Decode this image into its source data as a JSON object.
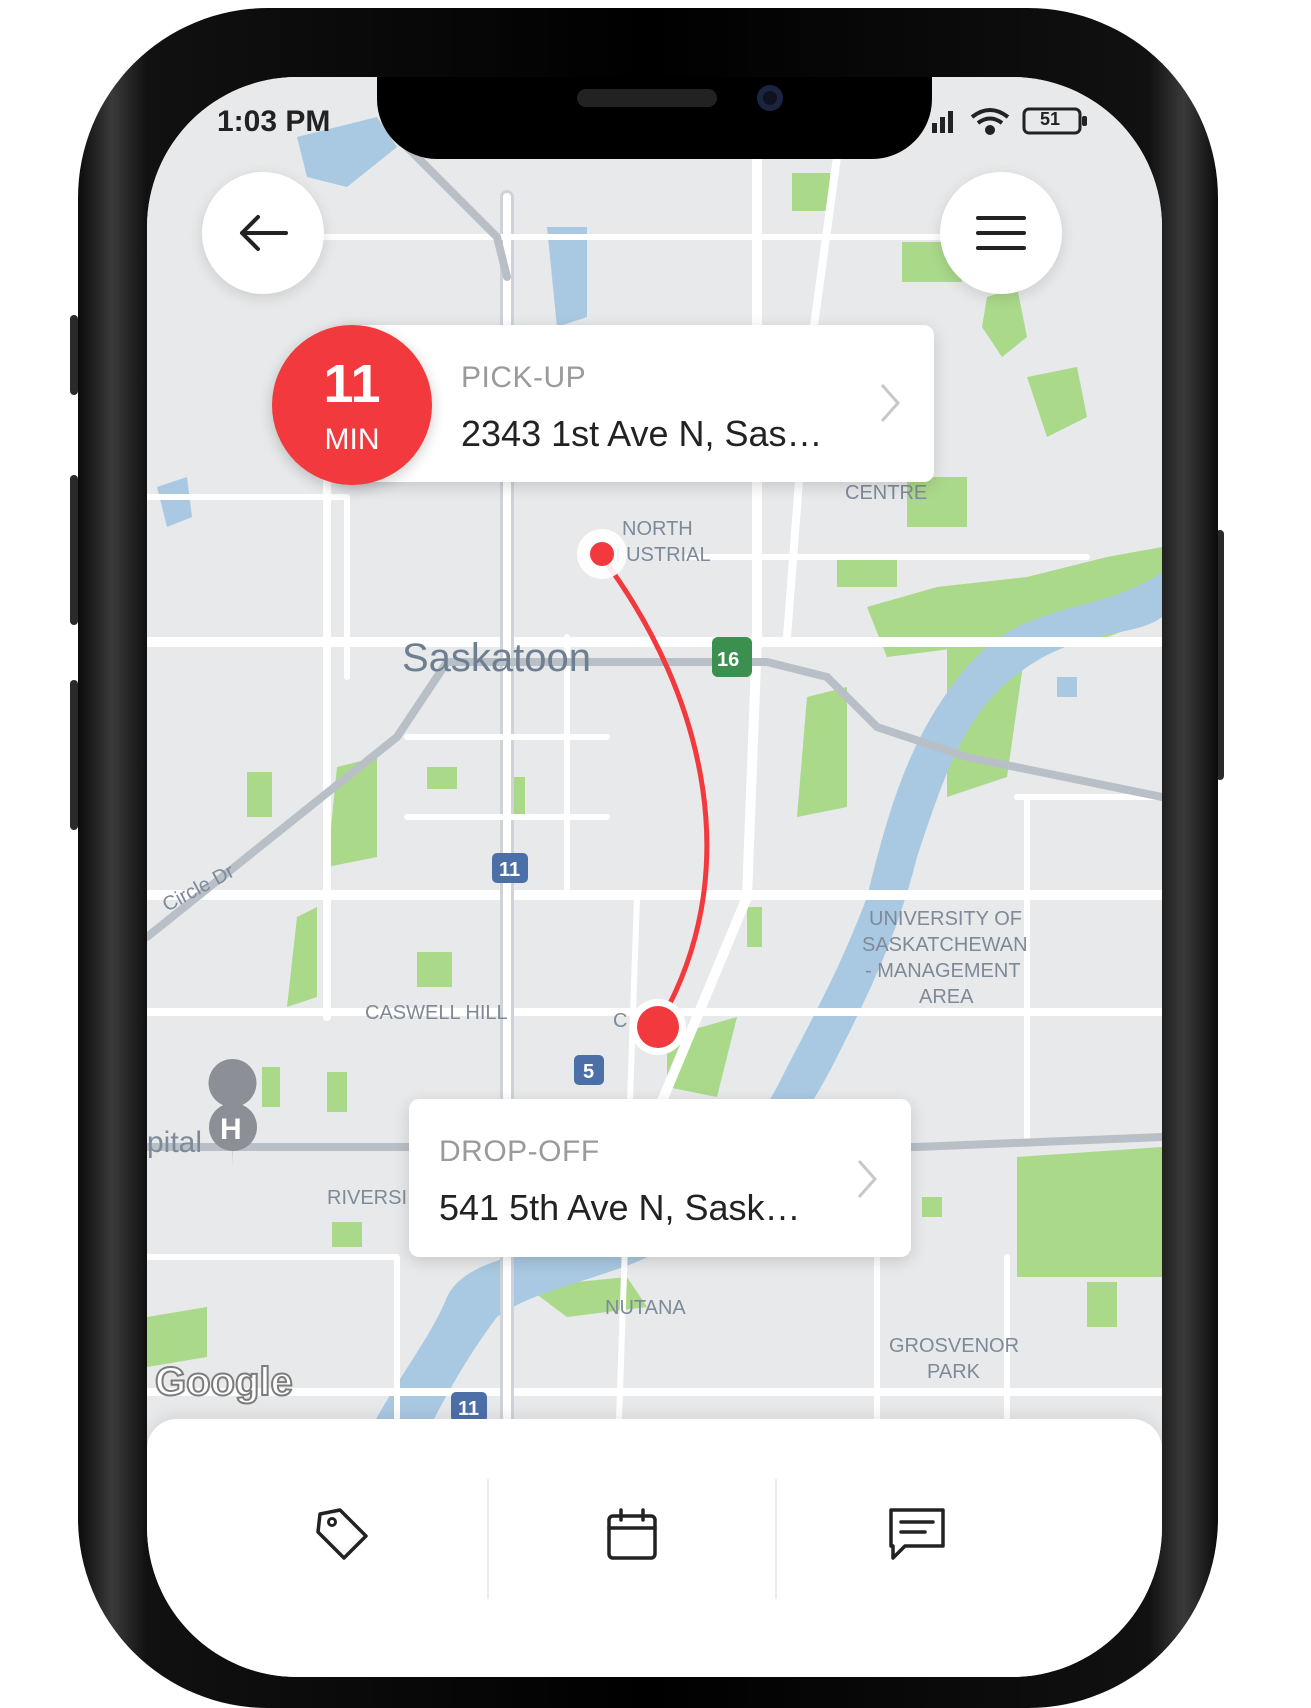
{
  "status": {
    "time": "1:03 PM",
    "battery": "51"
  },
  "route_badge": {
    "minutes": "11",
    "unit": "MIN"
  },
  "pickup": {
    "label": "PICK-UP",
    "address": "2343 1st Ave N, Sas…"
  },
  "dropoff": {
    "label": "DROP-OFF",
    "address": "541 5th Ave N, Sask…"
  },
  "map": {
    "city": "Saskatoon",
    "areas": {
      "centre": "CENTRE",
      "north_industrial_1": "NORTH",
      "north_industrial_2": "I  USTRIAL",
      "caswell_hill": "CASWELL HILL",
      "central_park": "C        ARK",
      "riversdale": "RIVERSI",
      "nutana": "NUTANA",
      "university_1": "UNIVERSITY OF",
      "university_2": "SASKATCHEWAN",
      "university_3": "- MANAGEMENT",
      "university_4": "AREA",
      "grosvenor_1": "GROSVENOR",
      "grosvenor_2": "PARK",
      "hospital": "pital"
    },
    "roads": {
      "circle_dr": "Circle Dr",
      "hwy11": "11",
      "hwy5": "5",
      "hwy16": "16"
    },
    "attribution": "Google"
  },
  "colors": {
    "accent": "#f23a3e",
    "map_bg": "#e7e9ea",
    "water": "#a9c9e2",
    "park": "#abd98a"
  },
  "icons": {
    "back": "arrow-left-icon",
    "menu": "hamburger-menu-icon",
    "tag": "tag-icon",
    "calendar": "calendar-icon",
    "chat": "chat-icon"
  }
}
